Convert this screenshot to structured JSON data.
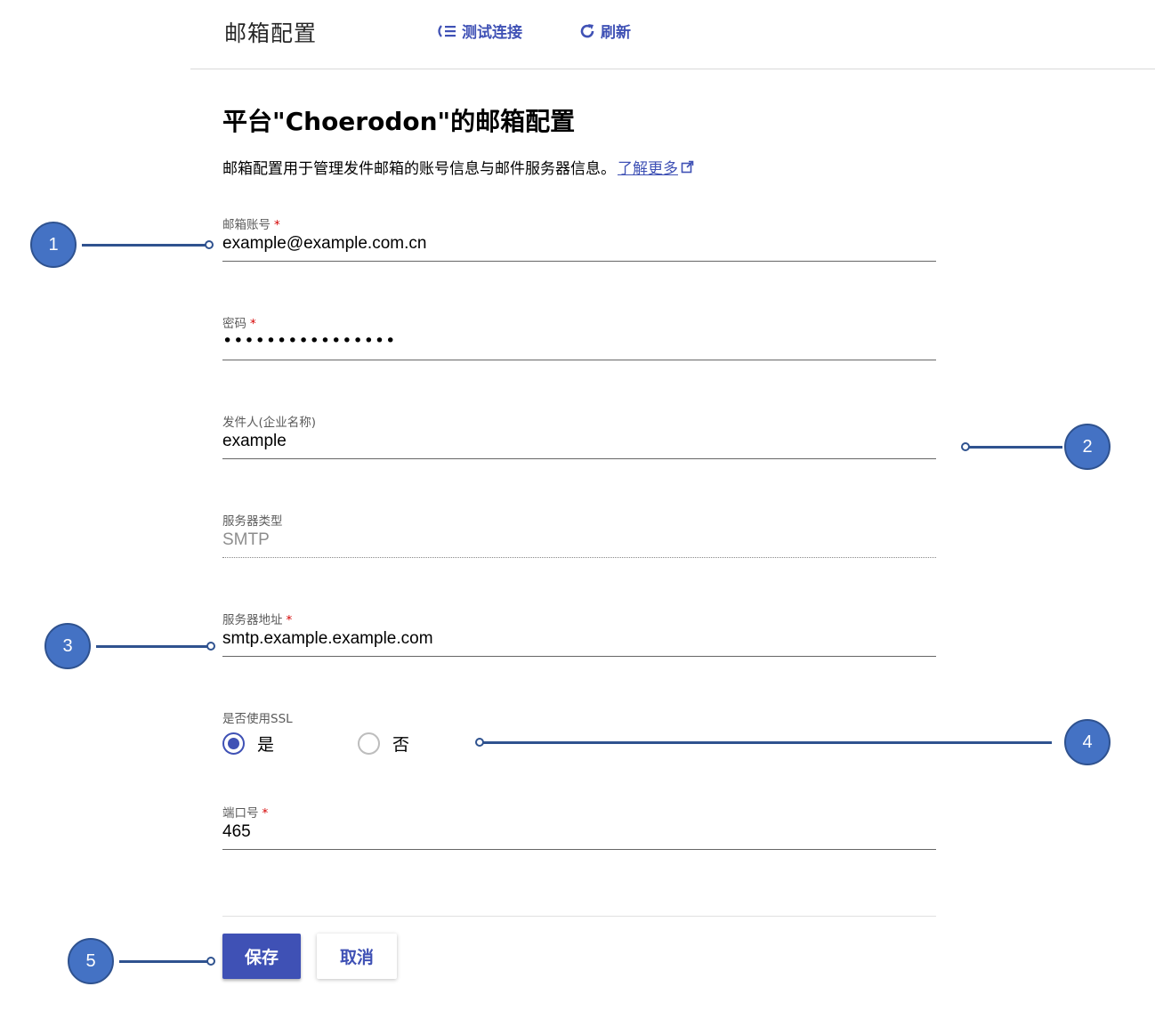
{
  "header": {
    "title": "邮箱配置",
    "test_label": "测试连接",
    "refresh_label": "刷新",
    "accent": "#3f51b5"
  },
  "page": {
    "title": "平台\"Choerodon\"的邮箱配置",
    "description": "邮箱配置用于管理发件邮箱的账号信息与邮件服务器信息。",
    "learn_more": "了解更多"
  },
  "form": {
    "account": {
      "label": "邮箱账号",
      "required": "*",
      "value": "example@example.com.cn"
    },
    "password": {
      "label": "密码",
      "required": "*",
      "masked": "••••••••••••••••"
    },
    "sender": {
      "label": "发件人(企业名称)",
      "value": "example"
    },
    "server_type": {
      "label": "服务器类型",
      "value": "SMTP"
    },
    "server_address": {
      "label": "服务器地址",
      "required": "*",
      "value": "smtp.example.example.com"
    },
    "ssl": {
      "label": "是否使用SSL",
      "yes": "是",
      "no": "否",
      "selected": "是"
    },
    "port": {
      "label": "端口号",
      "required": "*",
      "value": "465"
    }
  },
  "actions": {
    "save": "保存",
    "cancel": "取消"
  },
  "callouts": [
    "1",
    "2",
    "3",
    "4",
    "5"
  ]
}
